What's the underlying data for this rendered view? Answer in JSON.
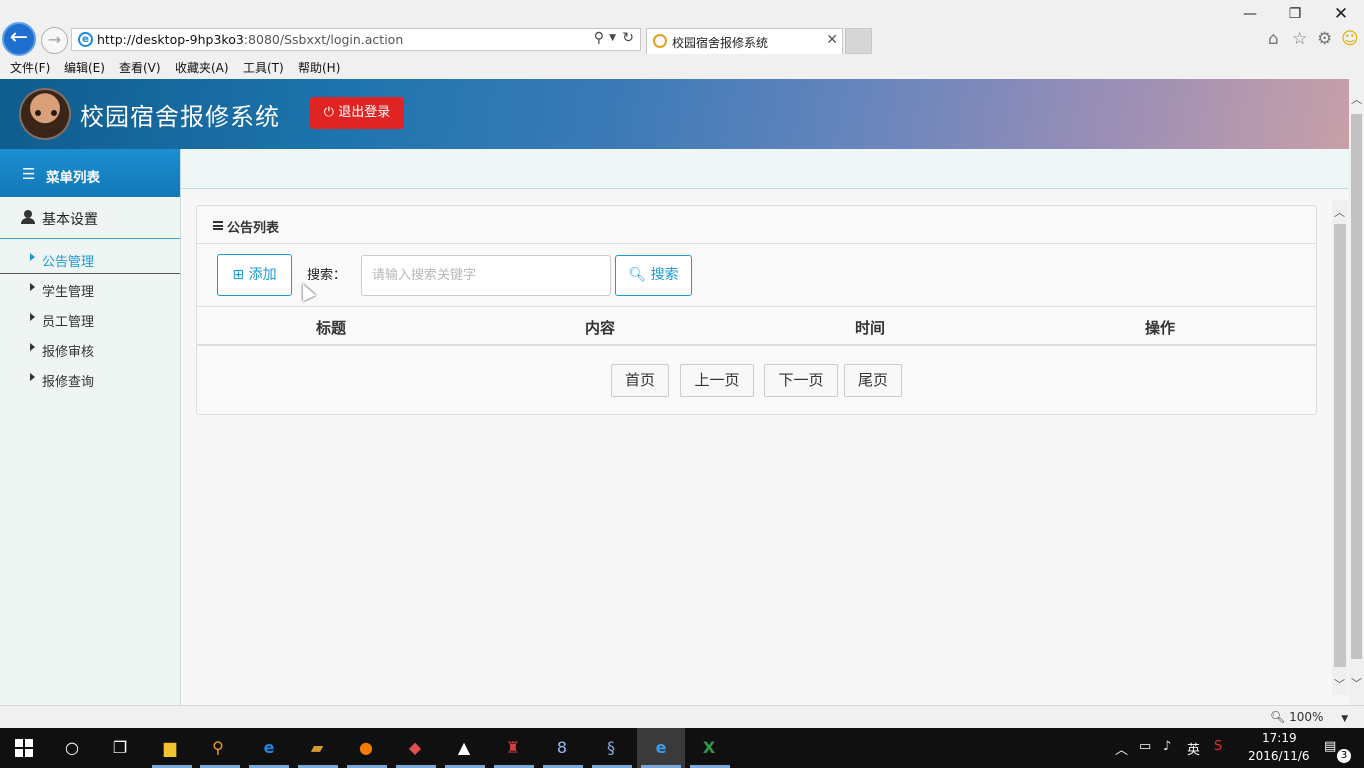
{
  "browser": {
    "url_host": "http://desktop-9hp3ko3",
    "url_rest": ":8080/Ssbxxt/login.action",
    "tab_title": "校园宿舍报修系统",
    "menu": [
      "文件(F)",
      "编辑(E)",
      "查看(V)",
      "收藏夹(A)",
      "工具(T)",
      "帮助(H)"
    ],
    "zoom": "100%",
    "icons": [
      "back-icon",
      "forward-icon",
      "search-icon",
      "refresh-icon",
      "home-icon",
      "star-icon",
      "gear-icon",
      "smiley-icon"
    ]
  },
  "header": {
    "title": "校园宿舍报修系统",
    "logout_label": "退出登录",
    "logout_icon": "⏻"
  },
  "sidebar": {
    "menu_title": "菜单列表",
    "section": "基本设置",
    "items": [
      {
        "label": "公告管理",
        "active": true
      },
      {
        "label": "学生管理",
        "active": false
      },
      {
        "label": "员工管理",
        "active": false
      },
      {
        "label": "报修审核",
        "active": false
      },
      {
        "label": "报修查询",
        "active": false
      }
    ]
  },
  "panel": {
    "title": "公告列表",
    "add_label": "添加",
    "search_label": "搜索：",
    "search_placeholder": "请输入搜索关键字",
    "search_button": "搜索",
    "columns": [
      "标题",
      "内容",
      "时间",
      "操作"
    ],
    "pagination": [
      "首页",
      "上一页",
      "下一页",
      "尾页"
    ]
  },
  "taskbar": {
    "time": "17:19",
    "date": "2016/11/6",
    "ime": "英",
    "notifications": "3"
  },
  "colors": {
    "accent": "#1a9bd8",
    "logout": "#e02424",
    "sidebar_bg": "#eff5f3"
  }
}
